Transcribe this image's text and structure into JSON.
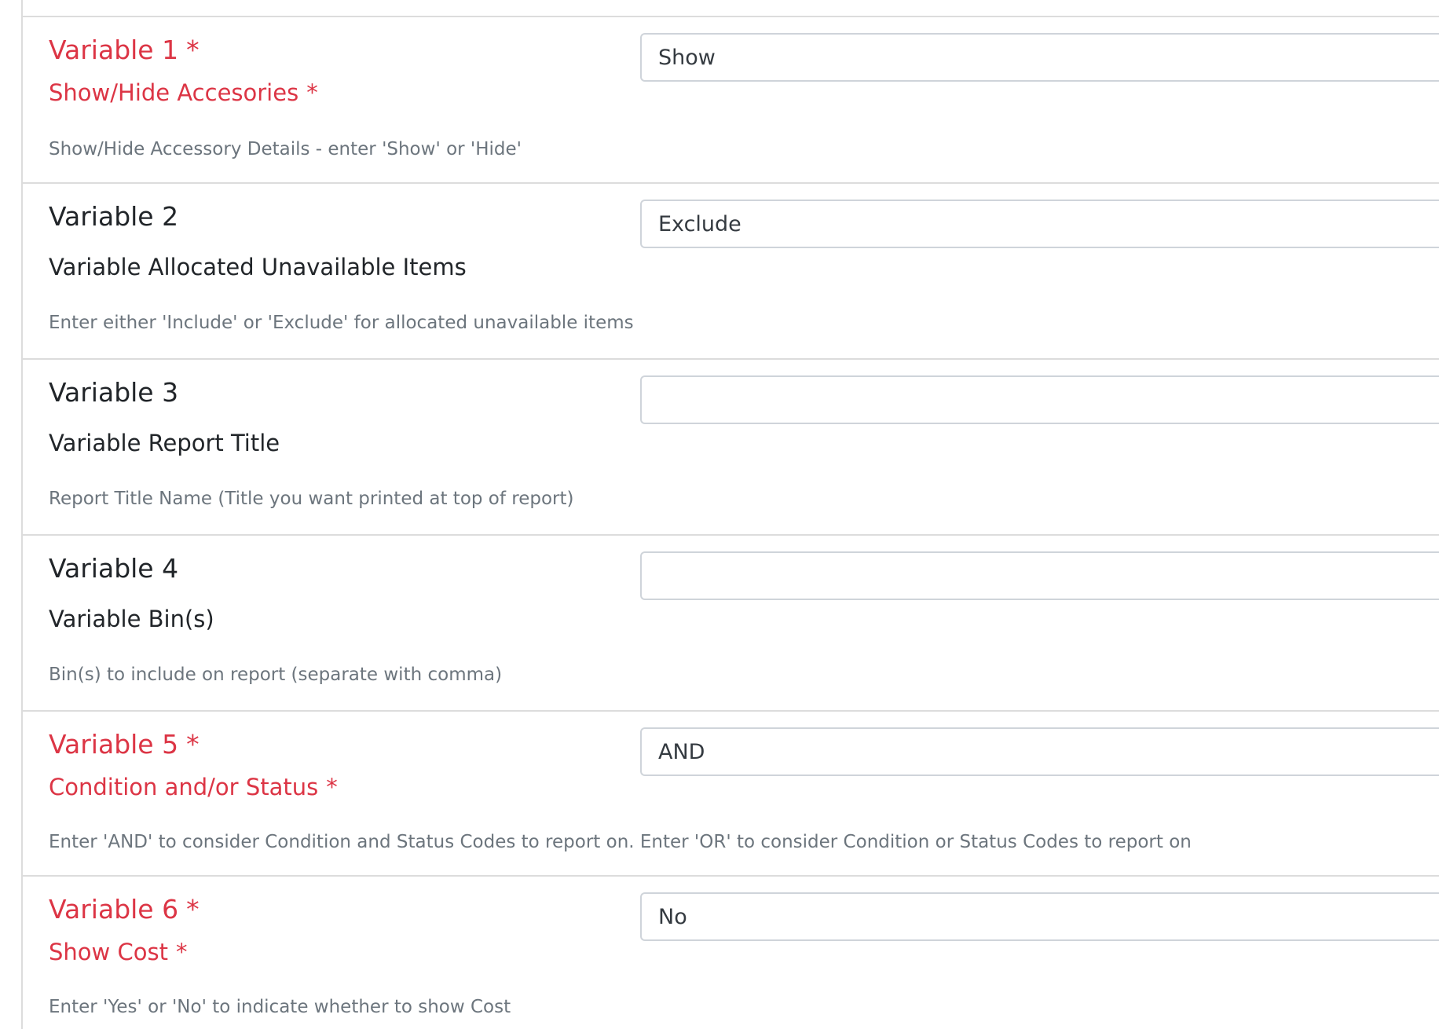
{
  "variables": [
    {
      "title": "Variable 1",
      "subtitle": "Show/Hide Accesories",
      "help": "Show/Hide Accessory Details - enter 'Show' or 'Hide'",
      "value": "Show",
      "required": true,
      "required_marker": "*"
    },
    {
      "title": "Variable 2",
      "subtitle": "Variable Allocated Unavailable Items",
      "help": "Enter either 'Include' or 'Exclude' for allocated unavailable items",
      "value": "Exclude",
      "required": false
    },
    {
      "title": "Variable 3",
      "subtitle": "Variable Report Title",
      "help": "Report Title Name (Title you want printed at top of report)",
      "value": "",
      "required": false
    },
    {
      "title": "Variable 4",
      "subtitle": "Variable Bin(s)",
      "help": "Bin(s) to include on report (separate with comma)",
      "value": "",
      "required": false
    },
    {
      "title": "Variable 5",
      "subtitle": "Condition and/or Status",
      "help": "Enter 'AND' to consider Condition and Status Codes to report on. Enter 'OR' to consider Condition or Status Codes to report on",
      "value": "AND",
      "required": true,
      "required_marker": "*"
    },
    {
      "title": "Variable 6",
      "subtitle": "Show Cost",
      "help": "Enter 'Yes' or 'No' to indicate whether to show Cost",
      "value": "No",
      "required": true,
      "required_marker": "*"
    }
  ],
  "colors": {
    "required_red": "#dc3545",
    "text_dark": "#212529",
    "help_gray": "#6c757d",
    "input_border": "#cfd4da",
    "divider": "#dcdcdc"
  }
}
